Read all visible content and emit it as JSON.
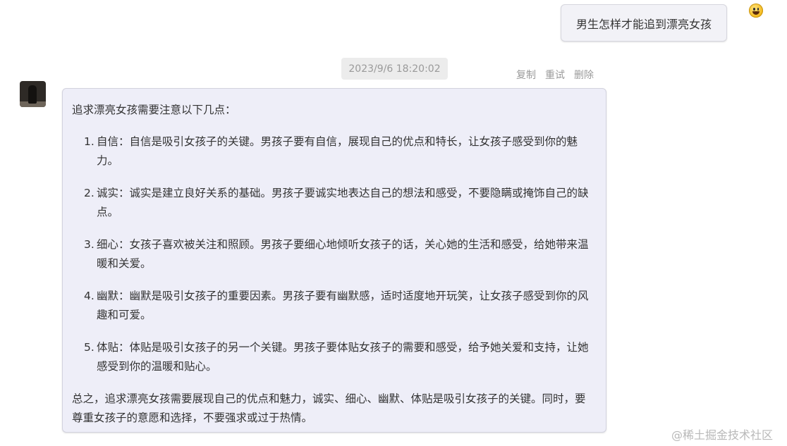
{
  "user_message": {
    "text": "男生怎样才能追到漂亮女孩",
    "avatar_icon": "smiley-emoji-icon"
  },
  "timestamp": "2023/9/6 18:20:02",
  "actions": {
    "copy": "复制",
    "retry": "重试",
    "delete": "删除"
  },
  "bot_message": {
    "intro": "追求漂亮女孩需要注意以下几点：",
    "points": [
      {
        "num": "1.",
        "text": "自信：自信是吸引女孩子的关键。男孩子要有自信，展现自己的优点和特长，让女孩子感受到你的魅力。"
      },
      {
        "num": "2.",
        "text": "诚实：诚实是建立良好关系的基础。男孩子要诚实地表达自己的想法和感受，不要隐瞒或掩饰自己的缺点。"
      },
      {
        "num": "3.",
        "text": "细心：女孩子喜欢被关注和照顾。男孩子要细心地倾听女孩子的话，关心她的生活和感受，给她带来温暖和关爱。"
      },
      {
        "num": "4.",
        "text": "幽默：幽默是吸引女孩子的重要因素。男孩子要有幽默感，适时适度地开玩笑，让女孩子感受到你的风趣和可爱。"
      },
      {
        "num": "5.",
        "text": "体贴：体贴是吸引女孩子的另一个关键。男孩子要体贴女孩子的需要和感受，给予她关爱和支持，让她感受到你的温暖和贴心。"
      }
    ],
    "summary": "总之，追求漂亮女孩需要展现自己的优点和魅力，诚实、细心、幽默、体贴是吸引女孩子的关键。同时，要尊重女孩子的意愿和选择，不要强求或过于热情。"
  },
  "watermark": "@稀土掘金技术社区"
}
